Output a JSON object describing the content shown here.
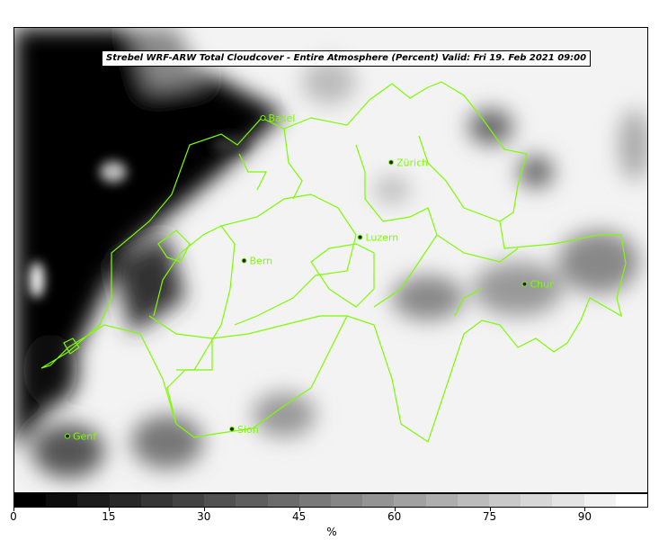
{
  "title": "Strebel WRF-ARW Total Cloudcover - Entire Atmosphere (Percent)   Valid: Fri 19. Feb 2021 09:00",
  "colorbar": {
    "ticks": [
      "0",
      "15",
      "30",
      "45",
      "60",
      "75",
      "90"
    ],
    "tick_values": [
      0,
      15,
      30,
      45,
      60,
      75,
      90
    ],
    "min": 0,
    "max": 100,
    "levels": 20,
    "unit": "%"
  },
  "cities": [
    {
      "name": "Basel",
      "lon": 7.59,
      "lat": 47.56
    },
    {
      "name": "Zürich",
      "lon": 8.54,
      "lat": 47.37
    },
    {
      "name": "Luzern",
      "lon": 8.31,
      "lat": 47.05
    },
    {
      "name": "Bern",
      "lon": 7.45,
      "lat": 46.95
    },
    {
      "name": "Chur",
      "lon": 9.53,
      "lat": 46.85
    },
    {
      "name": "Genf",
      "lon": 6.14,
      "lat": 46.2
    },
    {
      "name": "Sion",
      "lon": 7.36,
      "lat": 46.23
    }
  ],
  "colors": {
    "border": "#7cfc00",
    "dark": "#000000",
    "light": "#f7f7f7"
  }
}
